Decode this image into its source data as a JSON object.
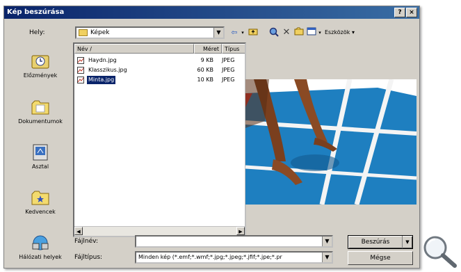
{
  "window": {
    "title": "Kép beszúrása",
    "help_label": "?",
    "close_label": "×"
  },
  "location": {
    "label": "Hely:",
    "value": "Képek"
  },
  "toolbar": {
    "tools_label": "Eszközök"
  },
  "places": [
    {
      "label": "Előzmények",
      "icon": "history-icon"
    },
    {
      "label": "Dokumentumok",
      "icon": "documents-folder-icon"
    },
    {
      "label": "Asztal",
      "icon": "desktop-icon"
    },
    {
      "label": "Kedvencek",
      "icon": "favorites-folder-icon"
    },
    {
      "label": "Hálózati helyek",
      "icon": "network-places-icon"
    }
  ],
  "columns": {
    "name": "Név",
    "size": "Méret",
    "type": "Típus"
  },
  "files": [
    {
      "name": "Haydn.jpg",
      "size": "9 KB",
      "type": "JPEG"
    },
    {
      "name": "Klasszikus.jpg",
      "size": "60 KB",
      "type": "JPEG"
    },
    {
      "name": "Minta.jpg",
      "size": "10 KB",
      "type": "JPEG",
      "selected": true
    }
  ],
  "filename": {
    "label": "Fájlnév:",
    "value": ""
  },
  "filetype": {
    "label": "Fájltípus:",
    "value": "Minden kép (*.emf;*.wmf;*.jpg;*.jpeg;*.jfif;*.jpe;*.pr"
  },
  "buttons": {
    "insert": "Beszúrás",
    "cancel": "Mégse"
  },
  "colors": {
    "title_start": "#0a246a",
    "title_end": "#3a6ea5",
    "dialog_bg": "#d4d0c8",
    "court_blue": "#1e7fc0"
  }
}
